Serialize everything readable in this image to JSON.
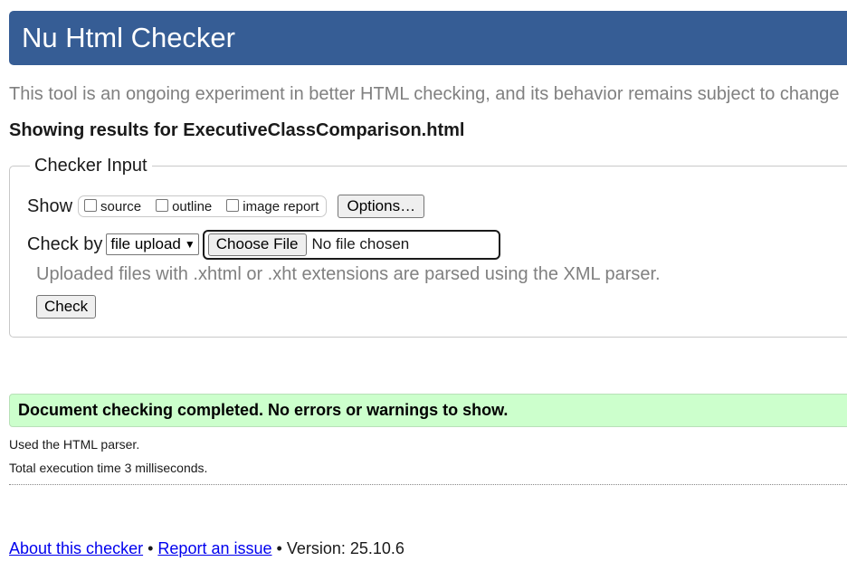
{
  "header": {
    "title": "Nu Html Checker"
  },
  "tagline": "This tool is an ongoing experiment in better HTML checking, and its behavior remains subject to change",
  "results_for": "Showing results for ExecutiveClassComparison.html",
  "checker_input": {
    "legend": "Checker Input",
    "show_label": "Show",
    "show_options": [
      {
        "label": "source",
        "checked": false
      },
      {
        "label": "outline",
        "checked": false
      },
      {
        "label": "image report",
        "checked": false
      }
    ],
    "options_button": "Options…",
    "check_by_label": "Check by",
    "check_by_selected": "file upload",
    "choose_file_button": "Choose File",
    "file_status": "No file chosen",
    "parser_note": "Uploaded files with .xhtml or .xht extensions are parsed using the XML parser.",
    "check_button": "Check"
  },
  "result": {
    "success_message": "Document checking completed. No errors or warnings to show.",
    "parser_used": "Used the HTML parser.",
    "execution_time": "Total execution time 3 milliseconds."
  },
  "footer": {
    "about_link": "About this checker",
    "separator": "•",
    "report_link": "Report an issue",
    "version": "Version: 25.10.6"
  },
  "colors": {
    "header_bg": "#365d95",
    "success_bg": "#ccffcc",
    "link": "#0000ee",
    "muted_text": "#808080"
  }
}
